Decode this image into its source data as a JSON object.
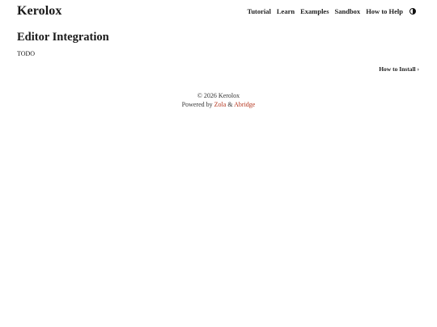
{
  "header": {
    "site_title": "Kerolox",
    "nav": [
      {
        "label": "Tutorial"
      },
      {
        "label": "Learn"
      },
      {
        "label": "Examples"
      },
      {
        "label": "Sandbox"
      },
      {
        "label": "How to Help"
      }
    ],
    "theme_toggle_icon": "half-circle-icon"
  },
  "main": {
    "title": "Editor Integration",
    "body": "TODO",
    "next_link": "How to Install ›"
  },
  "footer": {
    "copyright": "© 2026 Kerolox",
    "powered_by": "Powered by",
    "zola": "Zola",
    "amp": "&",
    "abridge": "Abridge"
  },
  "colors": {
    "link_accent": "#b5361f",
    "text": "#1a1a1a",
    "background": "#ffffff"
  }
}
